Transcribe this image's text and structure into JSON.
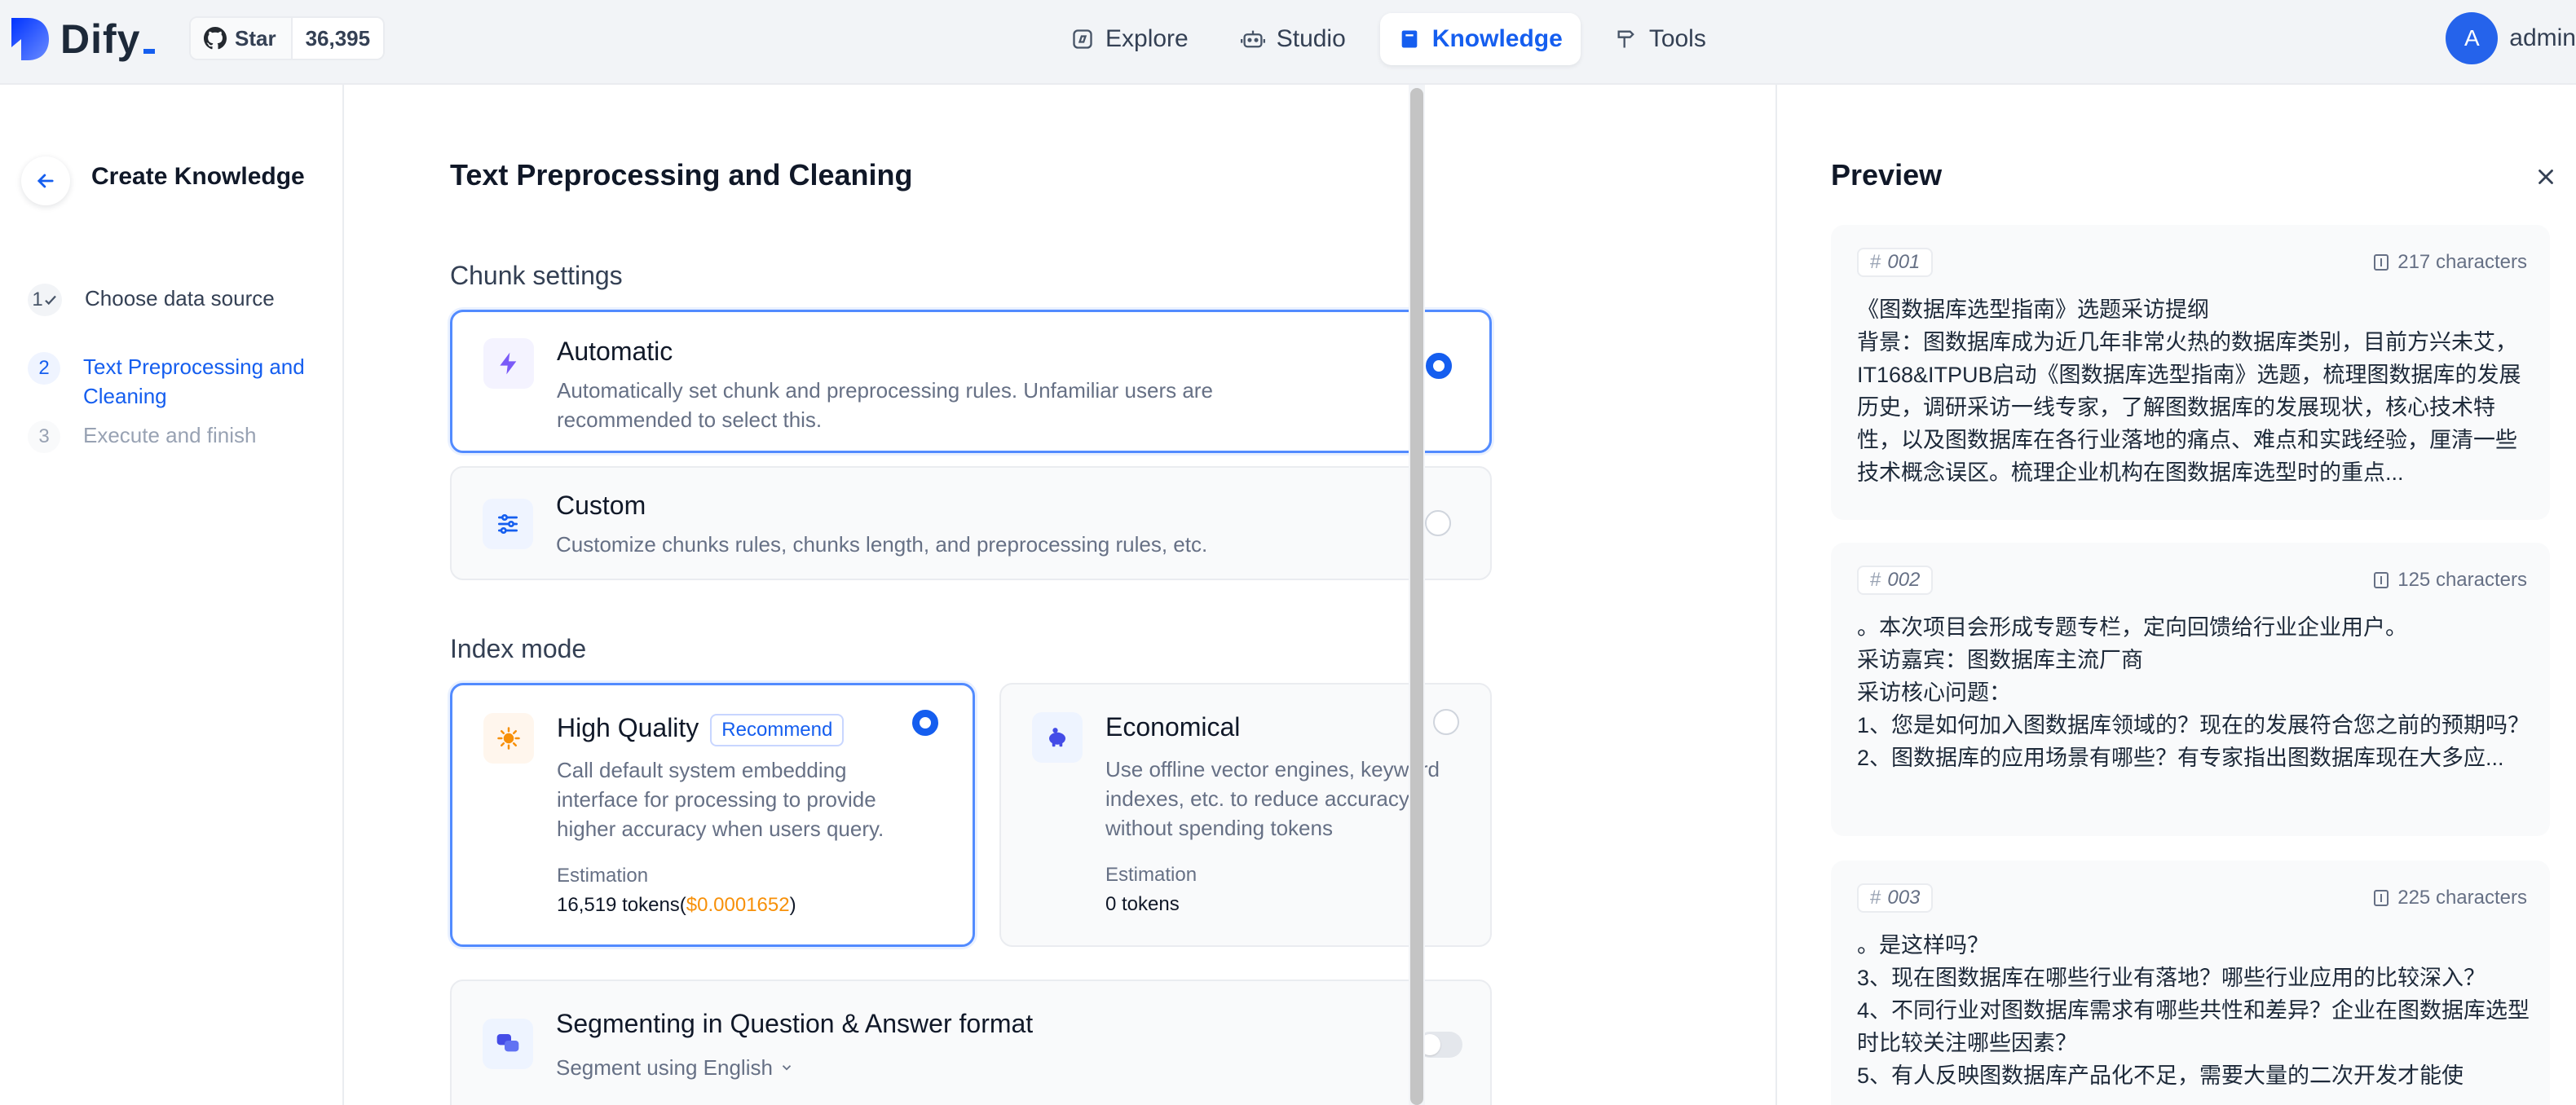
{
  "header": {
    "logo_text": "Dify",
    "github": {
      "star_label": "Star",
      "star_count": "36,395"
    },
    "nav": [
      {
        "label": "Explore",
        "icon": "compass-icon",
        "active": false
      },
      {
        "label": "Studio",
        "icon": "robot-icon",
        "active": false
      },
      {
        "label": "Knowledge",
        "icon": "book-icon",
        "active": true
      },
      {
        "label": "Tools",
        "icon": "hammer-icon",
        "active": false
      }
    ],
    "user": {
      "avatar_letter": "A",
      "name": "admin"
    }
  },
  "stepper": {
    "title": "Create Knowledge",
    "steps": [
      {
        "number": "1",
        "label": "Choose data source",
        "state": "done"
      },
      {
        "number": "2",
        "label": "Text Preprocessing and Cleaning",
        "state": "active"
      },
      {
        "number": "3",
        "label": "Execute and finish",
        "state": "pending"
      }
    ]
  },
  "main": {
    "title": "Text Preprocessing and Cleaning",
    "chunk_settings": {
      "heading": "Chunk settings",
      "automatic": {
        "title": "Automatic",
        "description": "Automatically set chunk and preprocessing rules. Unfamiliar users are recommended to select this.",
        "selected": true
      },
      "custom": {
        "title": "Custom",
        "description": "Customize chunks rules, chunks length, and preprocessing rules, etc.",
        "selected": false
      }
    },
    "index_mode": {
      "heading": "Index mode",
      "high_quality": {
        "title": "High Quality",
        "badge": "Recommend",
        "description": "Call default system embedding interface for processing to provide higher accuracy when users query.",
        "estimation_label": "Estimation",
        "estimation_tokens": "16,519 tokens(",
        "estimation_cost": "$0.0001652",
        "estimation_close": ")",
        "selected": true
      },
      "economical": {
        "title": "Economical",
        "description": "Use offline vector engines, keyword indexes, etc. to reduce accuracy without spending tokens",
        "estimation_label": "Estimation",
        "estimation_tokens": "0 tokens",
        "selected": false
      }
    },
    "qa_format": {
      "title": "Segmenting in Question & Answer format",
      "language_label": "Segment using English",
      "enabled": false
    }
  },
  "preview": {
    "title": "Preview",
    "chunks": [
      {
        "id": "001",
        "chars": "217 characters",
        "text": "《图数据库选型指南》选题采访提纲\n背景：图数据库成为近几年非常火热的数据库类别，目前方兴未艾，IT168&ITPUB启动《图数据库选型指南》选题，梳理图数据库的发展历史，调研采访一线专家，了解图数据库的发展现状，核心技术特性，以及图数据库在各行业落地的痛点、难点和实践经验，厘清一些技术概念误区。梳理企业机构在图数据库选型时的重点..."
      },
      {
        "id": "002",
        "chars": "125 characters",
        "text": "。本次项目会形成专题专栏，定向回馈给行业企业用户。\n采访嘉宾：图数据库主流厂商\n采访核心问题：\n1、您是如何加入图数据库领域的？现在的发展符合您之前的预期吗？\n2、图数据库的应用场景有哪些？有专家指出图数据库现在大多应..."
      },
      {
        "id": "003",
        "chars": "225 characters",
        "text": "。是这样吗？\n3、现在图数据库在哪些行业有落地？哪些行业应用的比较深入？\n4、不同行业对图数据库需求有哪些共性和差异？企业在图数据库选型时比较关注哪些因素？\n5、有人反映图数据库产品化不足，需要大量的二次开发才能使"
      }
    ]
  },
  "colors": {
    "accent": "#155eef",
    "cost": "#f79009",
    "header_bg": "#f2f4f7"
  }
}
